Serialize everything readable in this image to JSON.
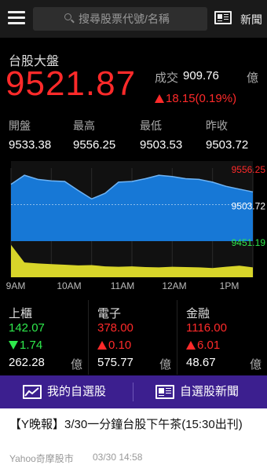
{
  "header": {
    "search_placeholder": "搜尋股票代號/名稱",
    "news_label": "新聞"
  },
  "index": {
    "name": "台股大盤",
    "price": "9521.87",
    "volume_label": "成交",
    "volume_value": "909.76",
    "volume_unit": "億",
    "change": "18.15(0.19%)"
  },
  "stats": [
    {
      "label": "開盤",
      "value": "9533.38"
    },
    {
      "label": "最高",
      "value": "9556.25"
    },
    {
      "label": "最低",
      "value": "9503.53"
    },
    {
      "label": "昨收",
      "value": "9503.72"
    }
  ],
  "chart_data": {
    "type": "area",
    "title": "",
    "price_labels": [
      "9556.25",
      "9503.72",
      "9451.19"
    ],
    "x_ticks": [
      "9AM",
      "10AM",
      "11AM",
      "12AM",
      "1PM"
    ],
    "ylim": [
      9451.19,
      9556.25
    ],
    "reference_line": 9503.72,
    "series": [
      {
        "name": "",
        "x": [
          "9:00",
          "9:15",
          "9:30",
          "9:45",
          "10:00",
          "10:15",
          "10:30",
          "10:45",
          "11:00",
          "11:15",
          "11:30",
          "11:45",
          "12:00",
          "12:15",
          "12:30",
          "12:45",
          "13:00",
          "13:15",
          "13:30"
        ],
        "values": [
          9533,
          9546,
          9540,
          9538,
          9537,
          9524,
          9512,
          9520,
          9536,
          9537,
          9541,
          9546,
          9544,
          9541,
          9540,
          9536,
          9530,
          9526,
          9522
        ]
      }
    ],
    "volume": {
      "values": [
        0.98,
        0.45,
        0.42,
        0.4,
        0.38,
        0.36,
        0.37,
        0.33,
        0.32,
        0.33,
        0.31,
        0.3,
        0.32,
        0.31,
        0.3,
        0.28,
        0.32,
        0.35,
        0.3
      ]
    },
    "colors": {
      "price_fill": "#1778d6",
      "price_line": "#6fb4f5",
      "volume_fill": "#d8d52a",
      "background": "#111111"
    }
  },
  "sectors": [
    {
      "name": "上櫃",
      "price": "142.07",
      "change": "1.74",
      "dir": "down",
      "value": "262.28",
      "unit": "億"
    },
    {
      "name": "電子",
      "price": "378.00",
      "change": "0.10",
      "dir": "up",
      "value": "575.77",
      "unit": "億"
    },
    {
      "name": "金融",
      "price": "1116.00",
      "change": "6.01",
      "dir": "up",
      "value": "48.67",
      "unit": "億"
    }
  ],
  "tabs": {
    "watchlist": "我的自選股",
    "watchlist_news": "自選股新聞"
  },
  "article": {
    "title": "【Y晚報】3/30一分鐘台股下午茶(15:30出刊)",
    "source": "Yahoo奇摩股市",
    "time": "03/30 14:58"
  },
  "colors": {
    "up": "#ff2a2a",
    "down": "#2ee84c",
    "accent": "#3c1f8f"
  }
}
